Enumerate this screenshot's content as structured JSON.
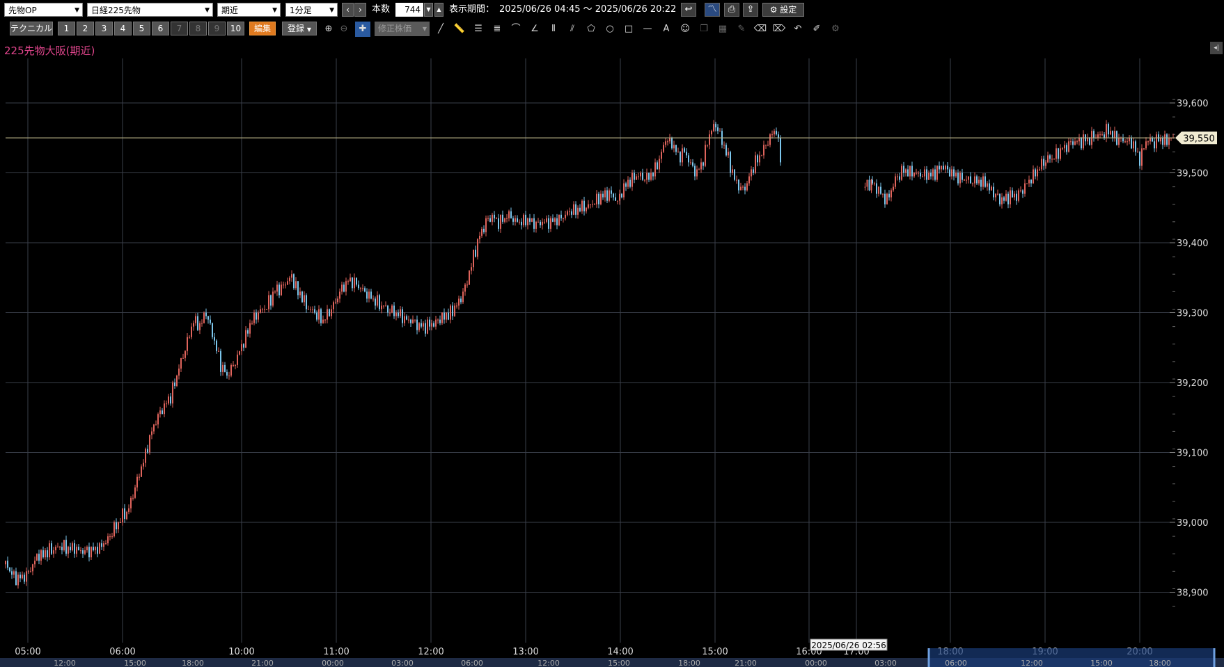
{
  "toolbar": {
    "category": "先物OP",
    "instrument": "日経225先物",
    "contract": "期近",
    "interval": "1分足",
    "prev_icon": "‹",
    "next_icon": "›",
    "count_label": "本数",
    "count_value": "744",
    "period_label": "表示期間：",
    "period_value": "2025/06/26 04:45 〜 2025/06/26 20:22",
    "settings_label": "設定"
  },
  "toolbar2": {
    "technical_label": "テクニカル",
    "presets": [
      "1",
      "2",
      "3",
      "4",
      "5",
      "6",
      "7",
      "8",
      "9",
      "10"
    ],
    "edit_label": "編集",
    "register_label": "登録",
    "adjusted_price_label": "修正株価"
  },
  "chart": {
    "title": "225先物大阪(期近)",
    "price_tag": "39,550",
    "cursor_date": "2025/06/26 02:56",
    "colors": {
      "up": "#e0645c",
      "down": "#7cc6ec",
      "grid": "#3a3f4a",
      "price_line": "#bdb58a",
      "title": "#e0458c"
    }
  },
  "chart_data": {
    "type": "candlestick",
    "ylim": [
      38880,
      39620
    ],
    "y_ticks": [
      "39,600",
      "39,500",
      "39,400",
      "39,300",
      "39,200",
      "39,100",
      "39,000",
      "38,900"
    ],
    "x_ticks": [
      "05:00",
      "06:00",
      "10:00",
      "11:00",
      "12:00",
      "13:00",
      "14:00",
      "15:00",
      "16:00",
      "17:00",
      "18:00",
      "19:00",
      "20:00"
    ],
    "nav_ticks": [
      "12:00",
      "15:00",
      "18:00",
      "21:00",
      "00:00",
      "03:00",
      "06:00",
      "12:00",
      "15:00",
      "18:00",
      "21:00",
      "00:00",
      "03:00",
      "06:00",
      "12:00",
      "15:00",
      "18:00"
    ],
    "last_price": 39550,
    "path": [
      [
        0,
        38940
      ],
      [
        10,
        38918
      ],
      [
        20,
        38925
      ],
      [
        30,
        38950
      ],
      [
        42,
        38960
      ],
      [
        54,
        38965
      ],
      [
        66,
        38962
      ],
      [
        78,
        38958
      ],
      [
        90,
        38962
      ],
      [
        100,
        38980
      ],
      [
        108,
        39000
      ],
      [
        118,
        39020
      ],
      [
        126,
        39060
      ],
      [
        134,
        39100
      ],
      [
        142,
        39140
      ],
      [
        150,
        39160
      ],
      [
        158,
        39180
      ],
      [
        166,
        39220
      ],
      [
        174,
        39260
      ],
      [
        180,
        39290
      ],
      [
        186,
        39280
      ],
      [
        192,
        39300
      ],
      [
        198,
        39270
      ],
      [
        206,
        39225
      ],
      [
        212,
        39210
      ],
      [
        220,
        39230
      ],
      [
        228,
        39260
      ],
      [
        236,
        39290
      ],
      [
        242,
        39300
      ],
      [
        250,
        39310
      ],
      [
        258,
        39330
      ],
      [
        266,
        39340
      ],
      [
        274,
        39350
      ],
      [
        280,
        39330
      ],
      [
        288,
        39310
      ],
      [
        296,
        39300
      ],
      [
        304,
        39290
      ],
      [
        312,
        39305
      ],
      [
        320,
        39330
      ],
      [
        328,
        39345
      ],
      [
        336,
        39340
      ],
      [
        344,
        39330
      ],
      [
        352,
        39320
      ],
      [
        360,
        39310
      ],
      [
        370,
        39300
      ],
      [
        380,
        39295
      ],
      [
        392,
        39285
      ],
      [
        404,
        39280
      ],
      [
        416,
        39290
      ],
      [
        426,
        39300
      ],
      [
        436,
        39320
      ],
      [
        442,
        39345
      ],
      [
        448,
        39380
      ],
      [
        454,
        39410
      ],
      [
        460,
        39430
      ],
      [
        466,
        39435
      ],
      [
        474,
        39430
      ],
      [
        482,
        39440
      ],
      [
        490,
        39430
      ],
      [
        500,
        39432
      ],
      [
        510,
        39428
      ],
      [
        520,
        39430
      ],
      [
        530,
        39435
      ],
      [
        540,
        39445
      ],
      [
        550,
        39448
      ],
      [
        560,
        39455
      ],
      [
        570,
        39465
      ],
      [
        578,
        39470
      ],
      [
        586,
        39460
      ],
      [
        592,
        39480
      ],
      [
        598,
        39490
      ],
      [
        606,
        39495
      ],
      [
        614,
        39492
      ],
      [
        620,
        39500
      ],
      [
        626,
        39520
      ],
      [
        632,
        39550
      ],
      [
        638,
        39540
      ],
      [
        644,
        39525
      ],
      [
        650,
        39530
      ],
      [
        656,
        39510
      ],
      [
        662,
        39500
      ],
      [
        668,
        39520
      ],
      [
        674,
        39555
      ],
      [
        680,
        39570
      ],
      [
        686,
        39545
      ],
      [
        692,
        39520
      ],
      [
        698,
        39490
      ],
      [
        704,
        39475
      ],
      [
        710,
        39485
      ],
      [
        716,
        39510
      ],
      [
        722,
        39525
      ],
      [
        728,
        39540
      ],
      [
        734,
        39555
      ],
      [
        738,
        39560
      ],
      [
        744,
        39500
      ],
      [
        823,
        39480
      ],
      [
        830,
        39485
      ],
      [
        838,
        39470
      ],
      [
        844,
        39460
      ],
      [
        852,
        39490
      ],
      [
        860,
        39505
      ],
      [
        868,
        39500
      ],
      [
        878,
        39495
      ],
      [
        888,
        39500
      ],
      [
        898,
        39510
      ],
      [
        908,
        39495
      ],
      [
        918,
        39492
      ],
      [
        928,
        39488
      ],
      [
        938,
        39486
      ],
      [
        946,
        39470
      ],
      [
        952,
        39460
      ],
      [
        960,
        39465
      ],
      [
        968,
        39468
      ],
      [
        976,
        39480
      ],
      [
        986,
        39500
      ],
      [
        994,
        39515
      ],
      [
        1000,
        39520
      ],
      [
        1008,
        39530
      ],
      [
        1016,
        39540
      ],
      [
        1024,
        39545
      ],
      [
        1032,
        39545
      ],
      [
        1040,
        39550
      ],
      [
        1048,
        39555
      ],
      [
        1056,
        39560
      ],
      [
        1064,
        39548
      ],
      [
        1072,
        39545
      ],
      [
        1080,
        39540
      ],
      [
        1086,
        39520
      ],
      [
        1092,
        39545
      ],
      [
        1100,
        39545
      ],
      [
        1110,
        39547
      ],
      [
        1120,
        39550
      ]
    ]
  }
}
